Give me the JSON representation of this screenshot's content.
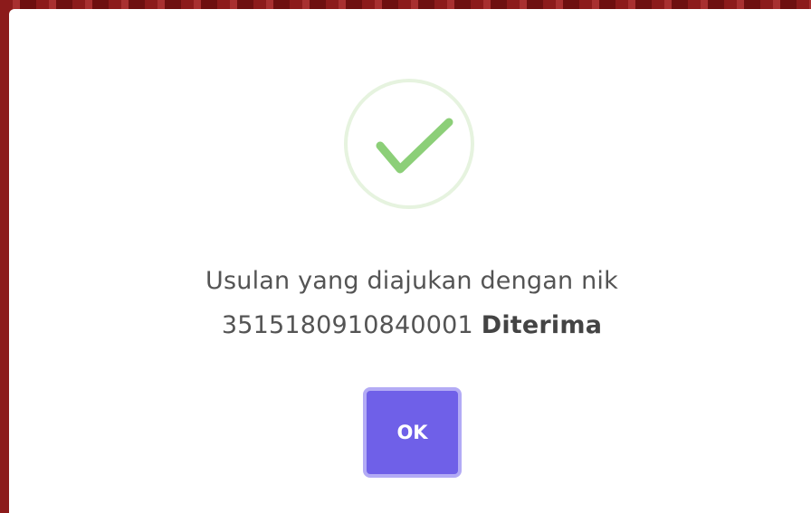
{
  "dialog": {
    "icon": "success-check-icon",
    "message_line1": "Usulan yang diajukan dengan nik",
    "message_nik": "3515180910840001",
    "message_status": "Diterima",
    "ok_label": "OK"
  },
  "colors": {
    "check": "#8ccf78",
    "ring": "#e6f3df",
    "button": "#6f60e8",
    "button_focus_ring": "#b3abf5",
    "text": "#545454",
    "backdrop": "#7a1515"
  }
}
